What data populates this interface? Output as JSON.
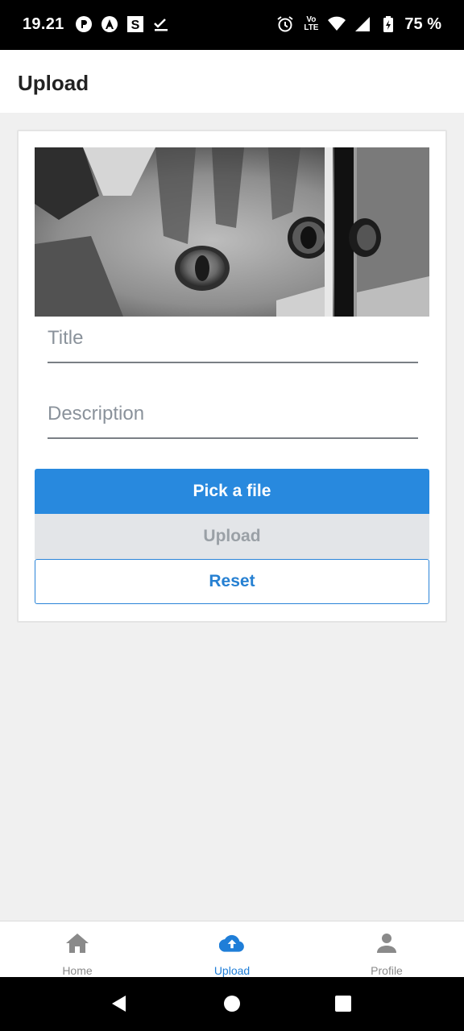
{
  "status_bar": {
    "time": "19.21",
    "battery": "75 %",
    "network_top": "Vo",
    "network_bottom": "LTE"
  },
  "header": {
    "title": "Upload"
  },
  "form": {
    "title_placeholder": "Title",
    "description_placeholder": "Description",
    "pick_label": "Pick a file",
    "upload_label": "Upload",
    "reset_label": "Reset"
  },
  "colors": {
    "primary": "#2889de",
    "active_nav": "#1f7ed8",
    "disabled_bg": "#e3e5e8"
  },
  "nav": {
    "items": [
      {
        "label": "Home",
        "icon": "home-icon"
      },
      {
        "label": "Upload",
        "icon": "cloud-upload-icon",
        "active": true
      },
      {
        "label": "Profile",
        "icon": "person-icon"
      }
    ]
  }
}
